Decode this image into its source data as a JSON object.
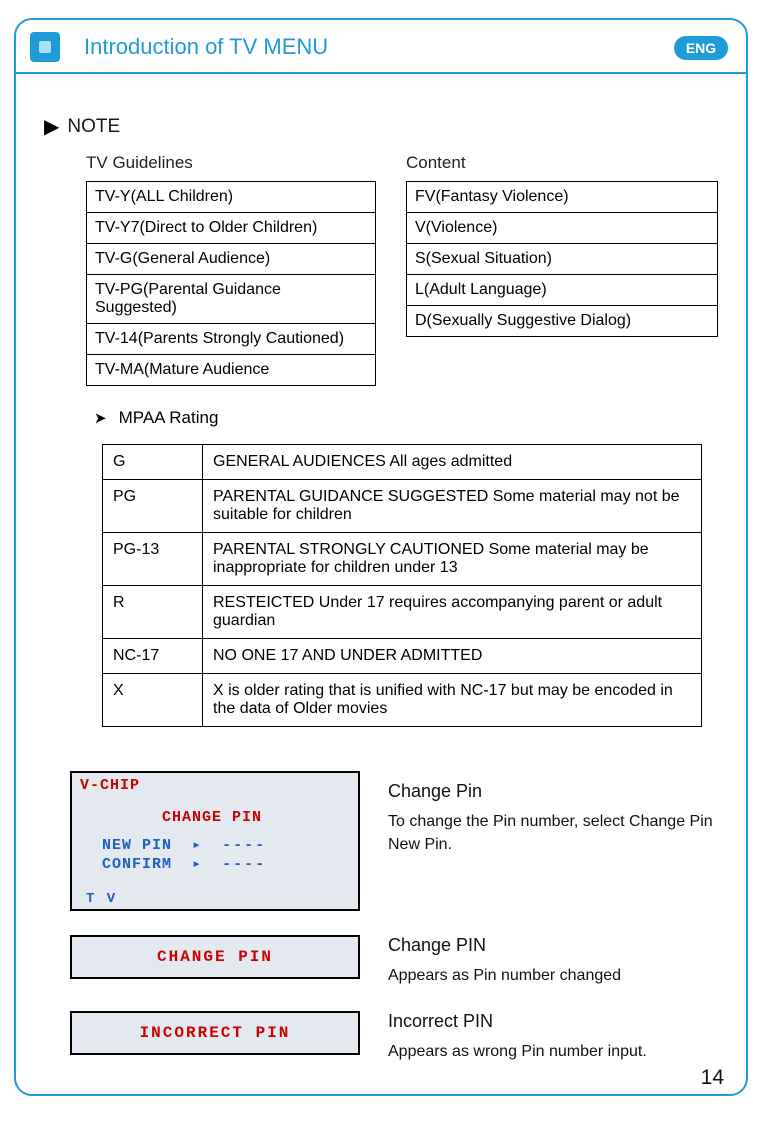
{
  "header": {
    "title": "Introduction of TV MENU",
    "lang_badge": "ENG"
  },
  "note_heading": "NOTE",
  "tv_guidelines": {
    "heading": "TV Guidelines",
    "items": [
      "TV-Y(ALL Children)",
      "TV-Y7(Direct to Older Children)",
      "TV-G(General Audience)",
      "TV-PG(Parental Guidance Suggested)",
      "TV-14(Parents Strongly Cautioned)",
      "TV-MA(Mature Audience"
    ]
  },
  "content_guidelines": {
    "heading": "Content",
    "items": [
      "FV(Fantasy Violence)",
      "V(Violence)",
      "S(Sexual Situation)",
      "L(Adult Language)",
      "D(Sexually Suggestive Dialog)"
    ]
  },
  "mpaa": {
    "heading": "MPAA Rating",
    "rows": [
      {
        "code": "G",
        "desc": "GENERAL AUDIENCES All ages admitted"
      },
      {
        "code": "PG",
        "desc": "PARENTAL GUIDANCE SUGGESTED Some material may not be suitable for children"
      },
      {
        "code": "PG-13",
        "desc": "PARENTAL STRONGLY CAUTIONED Some material may be inappropriate for children under 13"
      },
      {
        "code": "R",
        "desc": "RESTEICTED Under 17 requires accompanying parent or adult guardian"
      },
      {
        "code": "NC-17",
        "desc": "NO ONE 17 AND UNDER ADMITTED"
      },
      {
        "code": "X",
        "desc": "X is older rating that is unified with NC-17 but may be encoded in the data of Older movies"
      }
    ]
  },
  "vchip_box": {
    "title": "V-CHIP",
    "subtitle": "CHANGE  PIN",
    "new_pin_label": "NEW PIN",
    "confirm_label": "CONFIRM",
    "dashes": "----",
    "footer": "T V"
  },
  "change_pin_section": {
    "title": "Change Pin",
    "body": "To change the Pin number, select Change Pin New Pin."
  },
  "change_pin_box": {
    "label": "CHANGE  PIN",
    "title": "Change PIN",
    "body": "Appears as Pin number changed"
  },
  "incorrect_pin_box": {
    "label": "INCORRECT  PIN",
    "title": "Incorrect PIN",
    "body": "Appears as wrong Pin number input."
  },
  "page_number": "14"
}
